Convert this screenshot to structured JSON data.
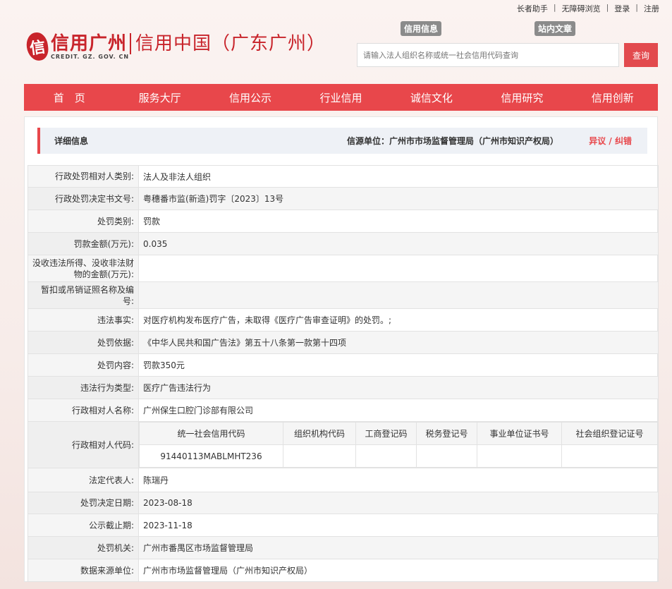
{
  "toplinks": [
    "长者助手",
    "无障碍浏览",
    "登录",
    "注册"
  ],
  "logo": {
    "mark": "信",
    "main": "信用广州",
    "sub": "信用中国（广东广州）",
    "en": "CREDIT. GZ. GOV. CN"
  },
  "search": {
    "tab1": "信用信息",
    "tab2": "站内文章",
    "placeholder": "请输入法人组织名称或统一社会信用代码查询",
    "button": "查询"
  },
  "nav": [
    "首　页",
    "服务大厅",
    "信用公示",
    "行业信用",
    "诚信文化",
    "信用研究",
    "信用创新"
  ],
  "detail": {
    "title": "详细信息",
    "source": "信源单位：广州市市场监督管理局（广州市知识产权局）",
    "objection": "异议 / 纠错"
  },
  "rows": [
    {
      "label": "行政处罚相对人类别:",
      "value": "法人及非法人组织"
    },
    {
      "label": "行政处罚决定书文号:",
      "value": "粤穗番市监(新造)罚字〔2023〕13号"
    },
    {
      "label": "处罚类别:",
      "value": "罚款"
    },
    {
      "label": "罚款金额(万元):",
      "value": "0.035"
    },
    {
      "label": "没收违法所得、没收非法财物的金额(万元):",
      "value": ""
    },
    {
      "label": "暂扣或吊销证照名称及编号:",
      "value": ""
    },
    {
      "label": "违法事实:",
      "value": "对医疗机构发布医疗广告，未取得《医疗广告审查证明》的处罚。;"
    },
    {
      "label": "处罚依据:",
      "value": "《中华人民共和国广告法》第五十八条第一款第十四项"
    },
    {
      "label": "处罚内容:",
      "value": "罚款350元"
    },
    {
      "label": "违法行为类型:",
      "value": "医疗广告违法行为"
    },
    {
      "label": "行政相对人名称:",
      "value": "广州保生口腔门诊部有限公司"
    }
  ],
  "codes": {
    "label": "行政相对人代码:",
    "headers": [
      "统一社会信用代码",
      "组织机构代码",
      "工商登记码",
      "税务登记号",
      "事业单位证书号",
      "社会组织登记证号"
    ],
    "values": [
      "91440113MABLMHT236",
      "",
      "",
      "",
      "",
      ""
    ]
  },
  "rows2": [
    {
      "label": "法定代表人:",
      "value": "陈瑞丹"
    },
    {
      "label": "处罚决定日期:",
      "value": "2023-08-18"
    },
    {
      "label": "公示截止期:",
      "value": "2023-11-18"
    },
    {
      "label": "处罚机关:",
      "value": "广州市番禺区市场监督管理局"
    },
    {
      "label": "数据来源单位:",
      "value": "广州市市场监督管理局（广州市知识产权局）"
    }
  ]
}
